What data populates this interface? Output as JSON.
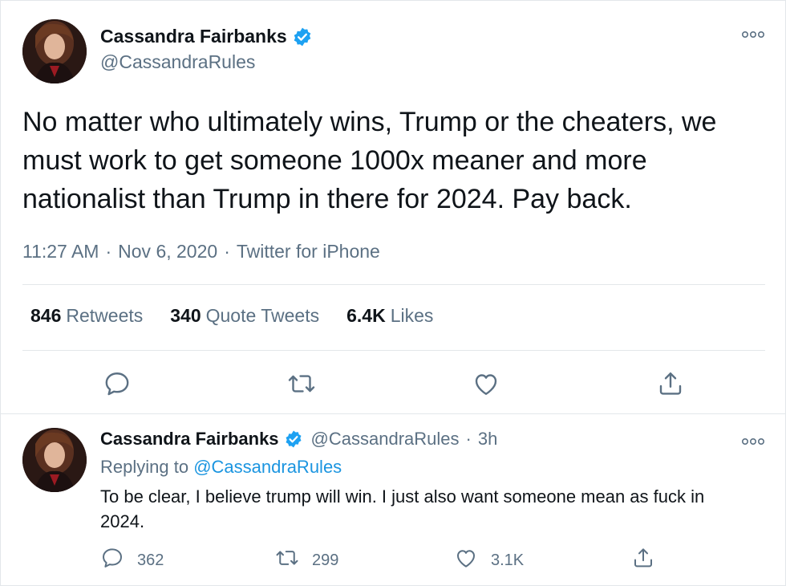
{
  "main_tweet": {
    "author_name": "Cassandra Fairbanks",
    "handle": "@CassandraRules",
    "text": "No matter who ultimately wins, Trump or the cheaters, we must work to get someone 1000x meaner and more nationalist than Trump in there for 2024. Pay back.",
    "time": "11:27 AM",
    "date": "Nov 6, 2020",
    "source": "Twitter for iPhone",
    "separator": "·",
    "stats": [
      {
        "count": "846",
        "label": "Retweets"
      },
      {
        "count": "340",
        "label": "Quote Tweets"
      },
      {
        "count": "6.4K",
        "label": "Likes"
      }
    ]
  },
  "reply_tweet": {
    "author_name": "Cassandra Fairbanks",
    "handle": "@CassandraRules",
    "time_ago": "3h",
    "separator": "·",
    "replying_to_label": "Replying to",
    "replying_to_handle": "@CassandraRules",
    "text": "To be clear, I believe trump will win. I just also want someone mean as fuck in 2024.",
    "reply_count": "362",
    "retweet_count": "299",
    "like_count": "3.1K"
  },
  "icons": [
    "verified-badge-icon",
    "more-options-icon",
    "reply-icon",
    "retweet-icon",
    "like-icon",
    "share-icon"
  ],
  "colors": {
    "text_primary": "#0f1419",
    "text_secondary": "#5b7083",
    "link": "#1b95e0",
    "verified": "#1da1f2",
    "divider": "#e3e7ea"
  }
}
